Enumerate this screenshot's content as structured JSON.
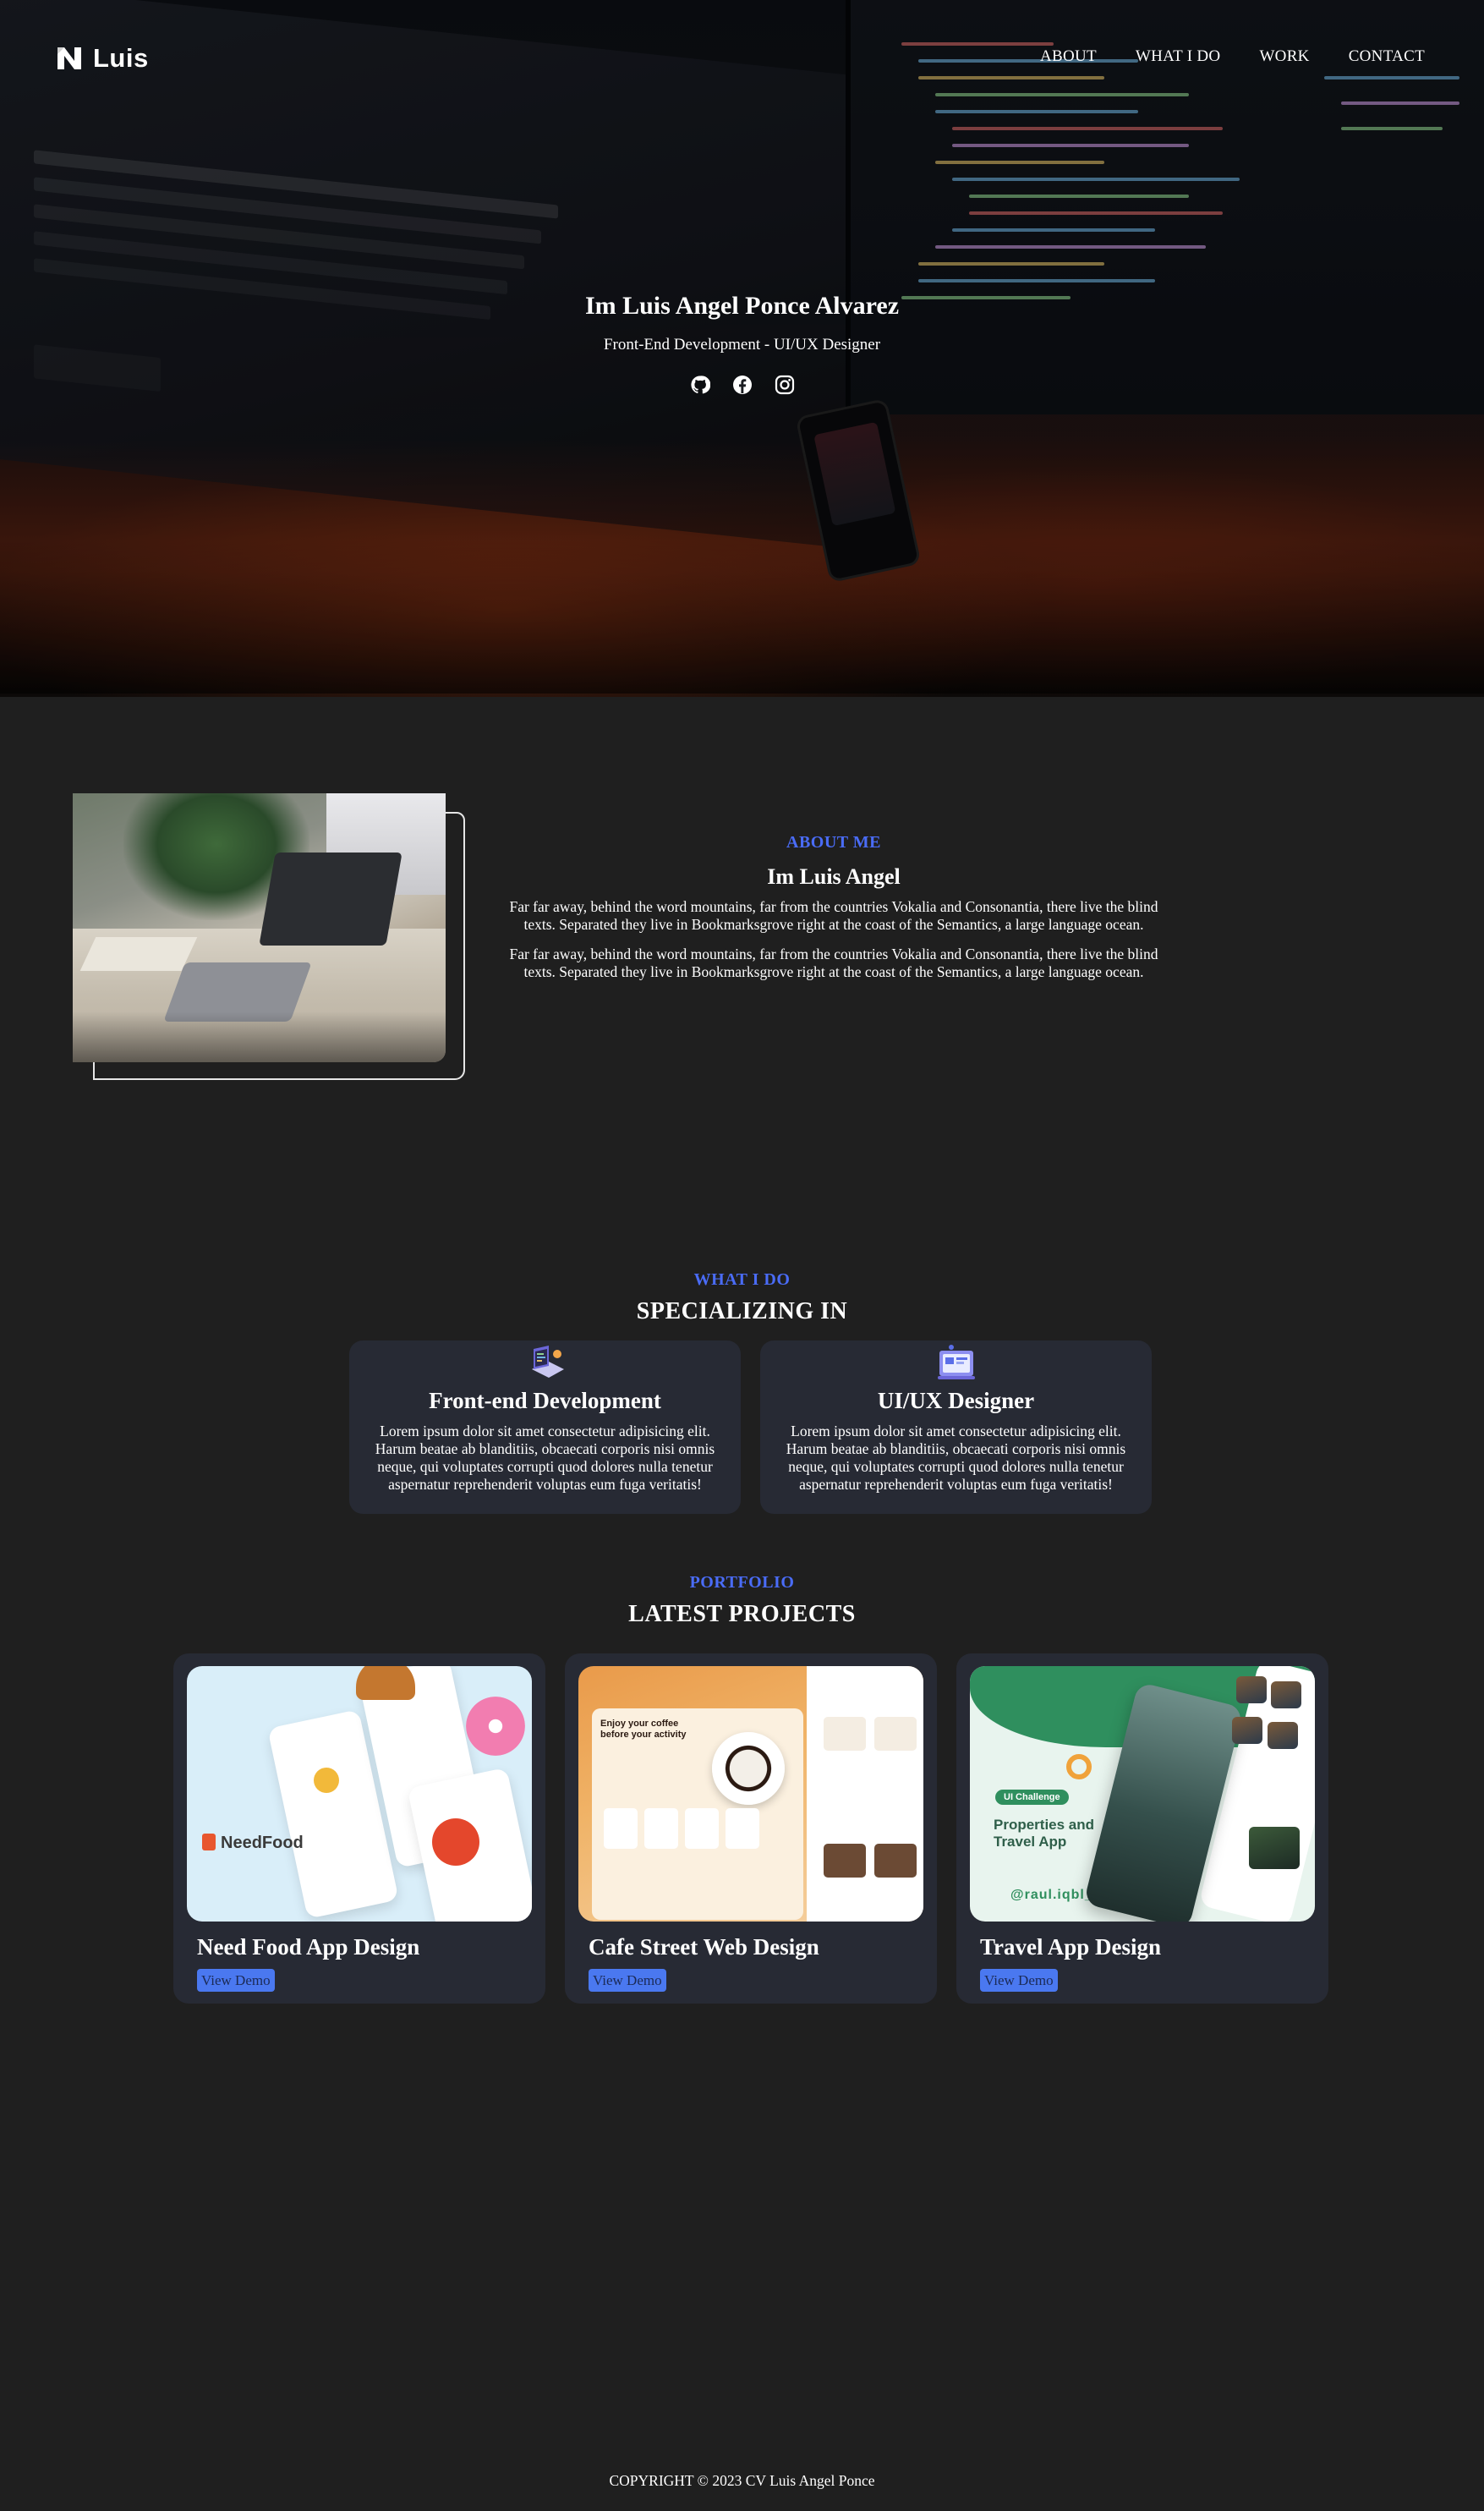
{
  "nav": {
    "logo_text": "Luis",
    "links": [
      "ABOUT",
      "WHAT I DO",
      "WORK",
      "CONTACT"
    ]
  },
  "hero": {
    "title": "Im Luis Angel Ponce Alvarez",
    "subtitle": "Front-End Development - UI/UX Designer",
    "socials": [
      "github-icon",
      "facebook-icon",
      "instagram-icon"
    ]
  },
  "about": {
    "kicker": "ABOUT ME",
    "name": "Im Luis Angel",
    "paragraphs": [
      "Far far away, behind the word mountains, far from the countries Vokalia and Consonantia, there live the blind texts. Separated they live in Bookmarksgrove right at the coast of the Semantics, a large language ocean.",
      "Far far away, behind the word mountains, far from the countries Vokalia and Consonantia, there live the blind texts. Separated they live in Bookmarksgrove right at the coast of the Semantics, a large language ocean."
    ]
  },
  "services": {
    "kicker": "WHAT I DO",
    "title": "SPECIALIZING IN",
    "items": [
      {
        "icon": "laptop-code-icon",
        "title": "Front-end Development",
        "description": "Lorem ipsum dolor sit amet consectetur adipisicing elit. Harum beatae ab blanditiis, obcaecati corporis nisi omnis neque, qui voluptates corrupti quod dolores nulla tenetur aspernatur reprehenderit voluptas eum fuga veritatis!"
      },
      {
        "icon": "design-board-icon",
        "title": "UI/UX Designer",
        "description": "Lorem ipsum dolor sit amet consectetur adipisicing elit. Harum beatae ab blanditiis, obcaecati corporis nisi omnis neque, qui voluptates corrupti quod dolores nulla tenetur aspernatur reprehenderit voluptas eum fuga veritatis!"
      }
    ]
  },
  "projects": {
    "kicker": "PORTFOLIO",
    "title": "LATEST PROJECTS",
    "items": [
      {
        "title": "Need Food App Design",
        "button": "View Demo",
        "thumb_texts": {
          "brand": "NeedFood"
        }
      },
      {
        "title": "Cafe Street Web Design",
        "button": "View Demo",
        "thumb_texts": {
          "heading": "Enjoy your coffee before your activity"
        }
      },
      {
        "title": "Travel App Design",
        "button": "View Demo",
        "thumb_texts": {
          "badge": "UI Challenge",
          "heading": "Properties and Travel App",
          "handle": "@raul.iqbl_"
        }
      }
    ]
  },
  "footer": {
    "copyright": "COPYRIGHT © 2023 CV Luis Angel Ponce"
  },
  "colors": {
    "page_background": "#1f1f1f",
    "card_background": "#272a34",
    "accent": "#4a6cf7",
    "button": "#4a78f0"
  }
}
